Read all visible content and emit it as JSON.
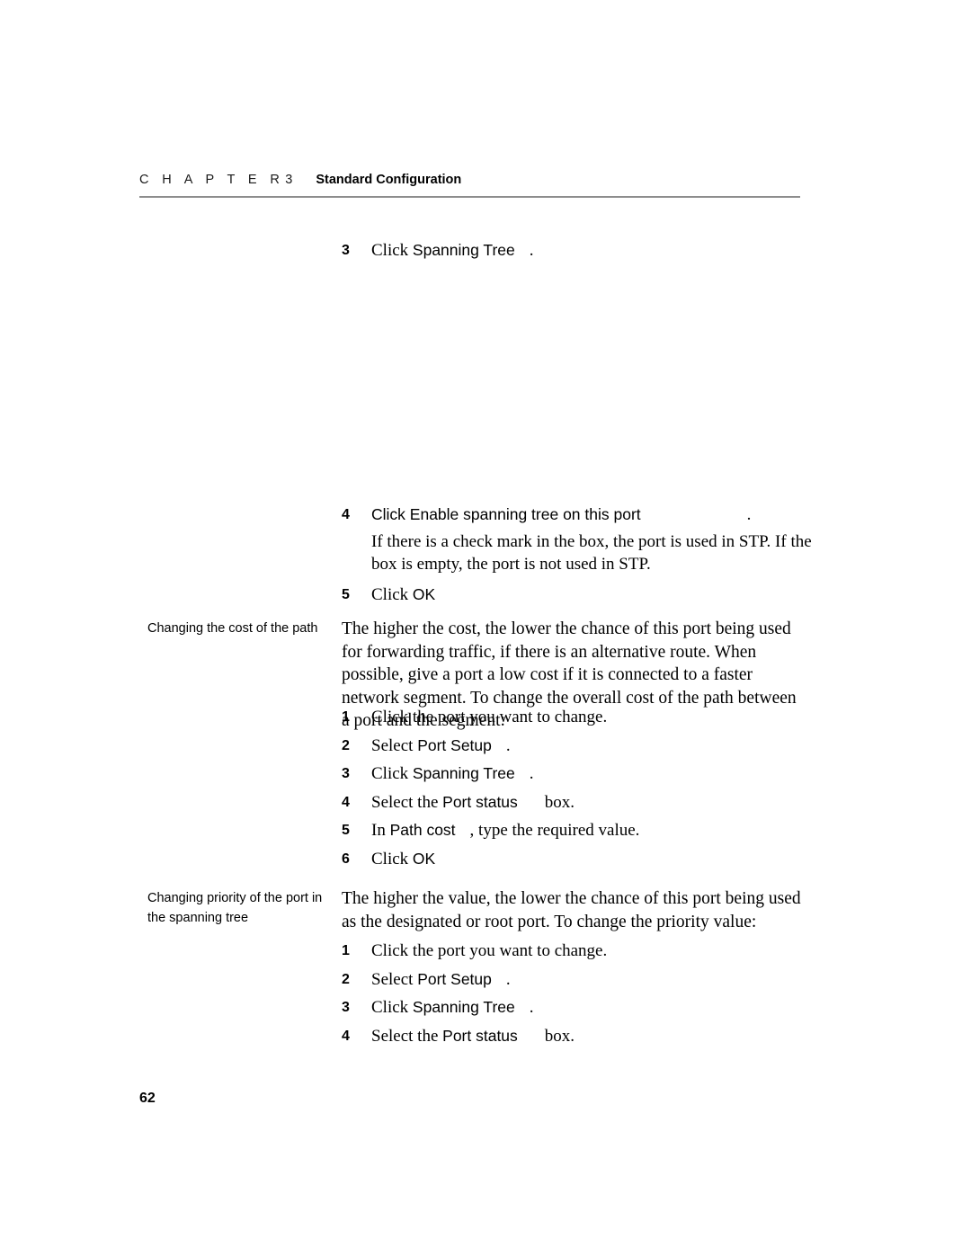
{
  "header": {
    "chapter_word": "C H A P T E R",
    "chapter_number": "3",
    "title": "Standard Configuration"
  },
  "footer": {
    "page_number": "62"
  },
  "sections": {
    "spanning_tree_steps": {
      "step3": {
        "num": "3",
        "verb": "Click",
        "ui_element": "Spanning Tree",
        "tail": "."
      },
      "step4": {
        "num": "4",
        "verb": "Click",
        "ui_element": "Enable spanning tree on this port",
        "tail": ".",
        "detail": "If there is a check mark in the box, the port is used in STP. If the box is empty, the port is not used in STP."
      },
      "step5": {
        "num": "5",
        "verb": "Click",
        "ui_element": "OK"
      }
    },
    "path_cost": {
      "margin_note": "Changing the cost of the path",
      "intro": "The higher the cost, the lower the chance of this port being used for forwarding traffic, if there is an alternative route. When possible, give a port a low cost if it is connected to a faster network segment. To change the overall cost of the path between a port and the segment:",
      "steps": [
        {
          "num": "1",
          "verb": "Click the port you want to change.",
          "ui_element": "",
          "tail": ""
        },
        {
          "num": "2",
          "verb": "Select",
          "ui_element": "Port Setup",
          "tail": "."
        },
        {
          "num": "3",
          "verb": "Click",
          "ui_element": "Spanning Tree",
          "tail": "."
        },
        {
          "num": "4",
          "verb": "Select the",
          "ui_element": "Port status",
          "tail": "box."
        },
        {
          "num": "5",
          "verb": "In",
          "ui_element": "Path cost",
          "tail": ", type the required value."
        },
        {
          "num": "6",
          "verb": "Click",
          "ui_element": "OK",
          "tail": ""
        }
      ]
    },
    "priority": {
      "margin_note": "Changing priority of the port in the spanning tree",
      "intro": "The higher the value, the lower the chance of this port being used as the designated or root port. To change the priority value:",
      "steps": [
        {
          "num": "1",
          "verb": "Click the port you want to change.",
          "ui_element": "",
          "tail": ""
        },
        {
          "num": "2",
          "verb": "Select",
          "ui_element": "Port Setup",
          "tail": "."
        },
        {
          "num": "3",
          "verb": "Click",
          "ui_element": "Spanning Tree",
          "tail": "."
        },
        {
          "num": "4",
          "verb": "Select the",
          "ui_element": "Port status",
          "tail": "box."
        }
      ]
    }
  }
}
